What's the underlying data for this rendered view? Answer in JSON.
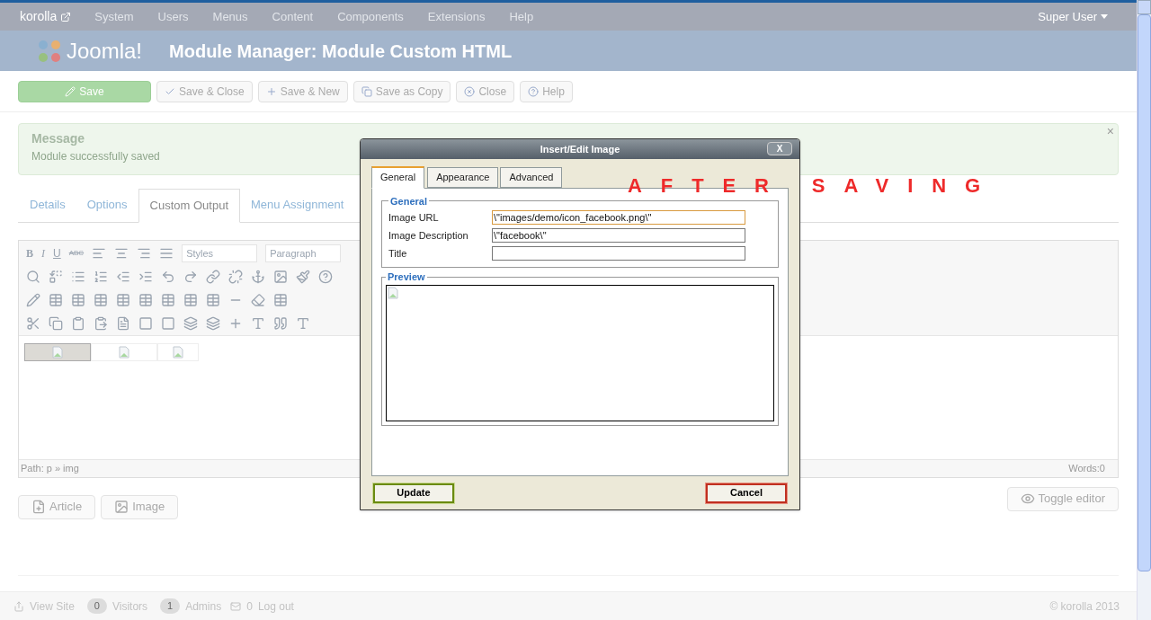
{
  "nav": {
    "brand": "korolla",
    "items": [
      "System",
      "Users",
      "Menus",
      "Content",
      "Components",
      "Extensions",
      "Help"
    ],
    "user": "Super User"
  },
  "header": {
    "logo_text": "Joomla!",
    "title": "Module Manager: Module Custom HTML"
  },
  "toolbar": [
    {
      "label": "Save",
      "kind": "primary"
    },
    {
      "label": "Save & Close",
      "kind": "default"
    },
    {
      "label": "Save & New",
      "kind": "default"
    },
    {
      "label": "Save as Copy",
      "kind": "default"
    },
    {
      "label": "Close",
      "kind": "default"
    },
    {
      "label": "Help",
      "kind": "default"
    }
  ],
  "message": {
    "title": "Message",
    "text": "Module successfully saved",
    "close": "×"
  },
  "tabs": [
    {
      "label": "Details",
      "selected": false
    },
    {
      "label": "Options",
      "selected": false
    },
    {
      "label": "Custom Output",
      "selected": true
    },
    {
      "label": "Menu Assignment",
      "selected": false
    }
  ],
  "editor": {
    "format_keys": [
      "B",
      "I",
      "U",
      "ABC"
    ],
    "styles": "Styles",
    "format": "Paragraph",
    "images": [
      {
        "selected": true
      },
      {
        "selected": false
      },
      {
        "selected": false
      }
    ],
    "path": "Path: p » img",
    "words": "Words:0"
  },
  "buttons": [
    "Article",
    "Image"
  ],
  "toggle": "Toggle editor",
  "footer": {
    "view_site": "View Site",
    "visitors_count": "0",
    "visitors": "Visitors",
    "admins_count": "1",
    "admins": "Admins",
    "messages_count": "0",
    "logout": "Log out",
    "copyright": "© korolla 2013"
  },
  "dialog": {
    "title": "Insert/Edit Image",
    "close": "X",
    "tabs": [
      {
        "label": "General",
        "selected": true
      },
      {
        "label": "Appearance",
        "selected": false
      },
      {
        "label": "Advanced",
        "selected": false
      }
    ],
    "general_legend": "General",
    "fields": [
      {
        "label": "Image URL",
        "value": "\\\"images/demo/icon_facebook.png\\\"",
        "focused": true
      },
      {
        "label": "Image Description",
        "value": "\\\"facebook\\\"",
        "focused": false
      },
      {
        "label": "Title",
        "focused": false
      }
    ],
    "preview_legend": "Preview",
    "update": "Update",
    "cancel": "Cancel"
  },
  "annotation": "AFTER SAVING"
}
